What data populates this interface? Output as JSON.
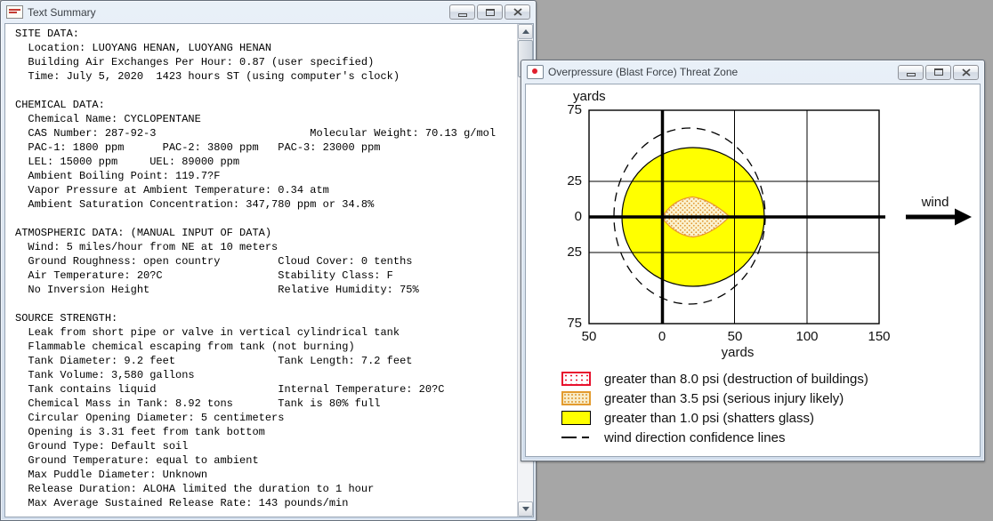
{
  "text_summary_window": {
    "title": "Text Summary",
    "controls": [
      "minimize",
      "maximize",
      "close"
    ],
    "content": "SITE DATA:\n  Location: LUOYANG HENAN, LUOYANG HENAN\n  Building Air Exchanges Per Hour: 0.87 (user specified)\n  Time: July 5, 2020  1423 hours ST (using computer's clock)\n\nCHEMICAL DATA:\n  Chemical Name: CYCLOPENTANE\n  CAS Number: 287-92-3                        Molecular Weight: 70.13 g/mol\n  PAC-1: 1800 ppm      PAC-2: 3800 ppm   PAC-3: 23000 ppm\n  LEL: 15000 ppm     UEL: 89000 ppm\n  Ambient Boiling Point: 119.7?F\n  Vapor Pressure at Ambient Temperature: 0.34 atm\n  Ambient Saturation Concentration: 347,780 ppm or 34.8%\n\nATMOSPHERIC DATA: (MANUAL INPUT OF DATA)\n  Wind: 5 miles/hour from NE at 10 meters\n  Ground Roughness: open country         Cloud Cover: 0 tenths\n  Air Temperature: 20?C                  Stability Class: F\n  No Inversion Height                    Relative Humidity: 75%\n\nSOURCE STRENGTH:\n  Leak from short pipe or valve in vertical cylindrical tank\n  Flammable chemical escaping from tank (not burning)\n  Tank Diameter: 9.2 feet                Tank Length: 7.2 feet\n  Tank Volume: 3,580 gallons\n  Tank contains liquid                   Internal Temperature: 20?C\n  Chemical Mass in Tank: 8.92 tons       Tank is 80% full\n  Circular Opening Diameter: 5 centimeters\n  Opening is 3.31 feet from tank bottom\n  Ground Type: Default soil\n  Ground Temperature: equal to ambient\n  Max Puddle Diameter: Unknown\n  Release Duration: ALOHA limited the duration to 1 hour\n  Max Average Sustained Release Rate: 143 pounds/min"
  },
  "threat_window": {
    "title": "Overpressure (Blast Force) Threat Zone",
    "controls": [
      "minimize",
      "maximize",
      "close"
    ]
  },
  "chart_data": {
    "type": "area",
    "title": "Overpressure (Blast Force) Threat Zone",
    "xlabel": "yards",
    "ylabel": "yards",
    "xlim": [
      -50,
      150
    ],
    "ylim": [
      -75,
      75
    ],
    "x_ticks": [
      "50",
      "0",
      "50",
      "100",
      "150"
    ],
    "y_ticks": [
      "75",
      "25",
      "0",
      "25",
      "75"
    ],
    "grid": "on",
    "wind_label": "wind",
    "wind_direction": "blowing toward +x (arrow points right)",
    "zones": [
      {
        "level": "red",
        "label": "greater than 8.0 psi (destruction of buildings)",
        "drawn_in_plot": false
      },
      {
        "level": "orange",
        "label": "greater than 3.5 psi (serious injury likely)",
        "shape": "lens",
        "x_extent_yards": [
          0,
          47
        ],
        "y_extent_yards": [
          -14,
          14
        ]
      },
      {
        "level": "yellow",
        "label": "greater than 1.0 psi (shatters glass)",
        "shape": "circle",
        "center_yards": [
          21,
          0
        ],
        "radius_yards": 49
      }
    ],
    "confidence_lines": {
      "label": "wind direction confidence lines",
      "shape": "dashed ellipse",
      "center_yards": [
        19,
        0
      ],
      "rx_yards": 52,
      "ry_yards": 61
    },
    "legend": [
      {
        "swatch": "red-dots",
        "label": "greater than 8.0 psi (destruction of buildings)"
      },
      {
        "swatch": "orange-dots",
        "label": "greater than 3.5 psi (serious injury likely)"
      },
      {
        "swatch": "yellow-solid",
        "label": "greater than 1.0 psi (shatters glass)"
      },
      {
        "swatch": "dashed-line",
        "label": "wind direction confidence lines"
      }
    ],
    "colors": {
      "yellow_zone": "#ffff00",
      "orange_zone_border": "#e8962e",
      "red_zone_border": "#e8112d",
      "axis": "#000000",
      "desktop_background": "#a6a6a6"
    }
  }
}
